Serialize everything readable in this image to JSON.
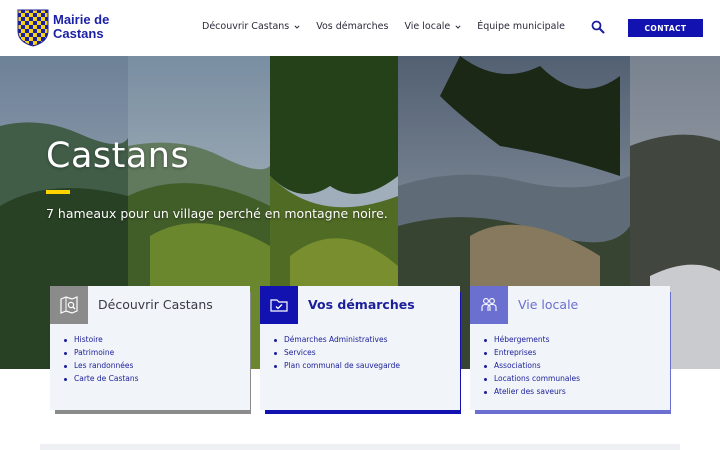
{
  "header": {
    "site_title_line1": "Mairie de",
    "site_title_line2": "Castans",
    "nav": [
      {
        "label": "Découvrir Castans",
        "has_dropdown": true
      },
      {
        "label": "Vos démarches",
        "has_dropdown": false
      },
      {
        "label": "Vie locale",
        "has_dropdown": true
      },
      {
        "label": "Équipe municipale",
        "has_dropdown": false
      }
    ],
    "contact_label": "CONTACT"
  },
  "hero": {
    "title": "Castans",
    "subtitle": "7 hameaux pour un village perché en montagne noire."
  },
  "cards": [
    {
      "title": "Découvrir Castans",
      "icon": "map-search-icon",
      "accent": "#8b8b8b",
      "title_color": "#3a3a48",
      "items": [
        "Histoire",
        "Patrimoine",
        "Les randonnées",
        "Carte de Castans"
      ]
    },
    {
      "title": "Vos démarches",
      "icon": "folder-check-icon",
      "accent": "#1212b0",
      "title_color": "#1b1f9a",
      "items": [
        "Démarches Administratives",
        "Services",
        "Plan communal de sauvegarde"
      ]
    },
    {
      "title": "Vie locale",
      "icon": "people-icon",
      "accent": "#6b6fd0",
      "title_color": "#6b6fd0",
      "items": [
        "Hébergements",
        "Entreprises",
        "Associations",
        "Locations communales",
        "Atelier des saveurs"
      ]
    }
  ],
  "colors": {
    "brand_blue": "#1212b0",
    "hero_accent": "#ffd400"
  }
}
